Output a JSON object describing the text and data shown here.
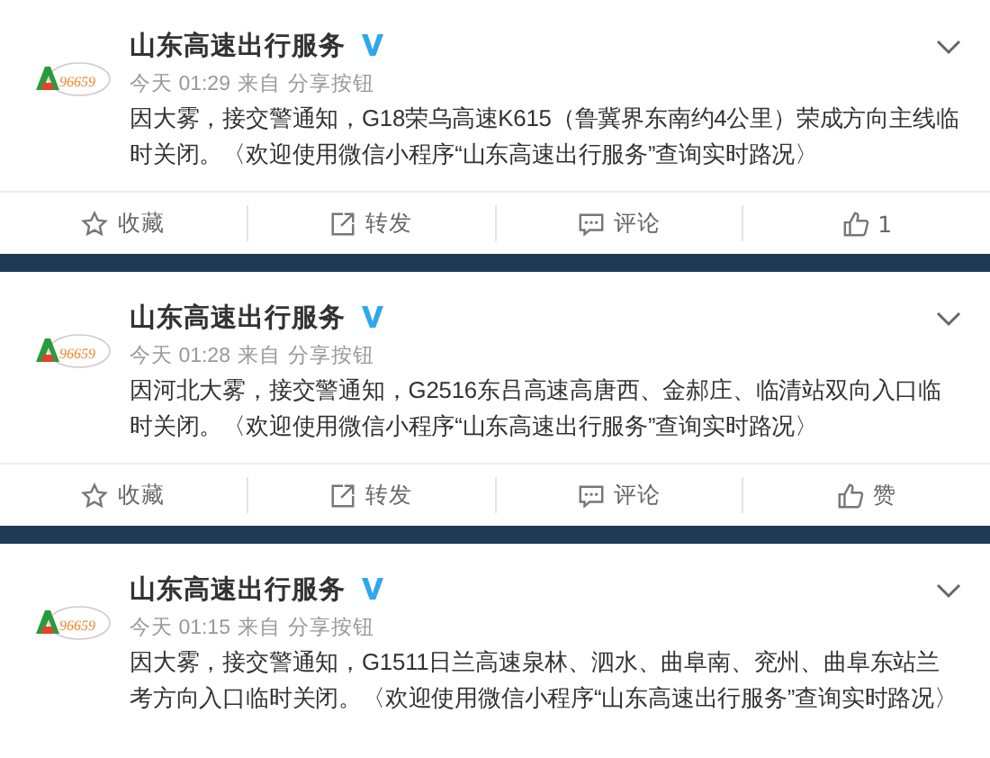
{
  "posts": [
    {
      "author": "山东高速出行服务",
      "verified": true,
      "avatar_label": "96659",
      "time": "今天 01:29",
      "source_prefix": "来自",
      "source": "分享按钮",
      "text": "因大雾，接交警通知，G18荣乌高速K615（鲁冀界东南约4公里）荣成方向主线临时关闭。〈欢迎使用微信小程序“山东高速出行服务”查询实时路况〉",
      "actions": [
        {
          "kind": "favorite",
          "label": "收藏"
        },
        {
          "kind": "repost",
          "label": "转发"
        },
        {
          "kind": "comment",
          "label": "评论"
        },
        {
          "kind": "like",
          "label": "1"
        }
      ]
    },
    {
      "author": "山东高速出行服务",
      "verified": true,
      "avatar_label": "96659",
      "time": "今天 01:28",
      "source_prefix": "来自",
      "source": "分享按钮",
      "text": "因河北大雾，接交警通知，G2516东吕高速高唐西、金郝庄、临清站双向入口临时关闭。〈欢迎使用微信小程序“山东高速出行服务”查询实时路况〉",
      "actions": [
        {
          "kind": "favorite",
          "label": "收藏"
        },
        {
          "kind": "repost",
          "label": "转发"
        },
        {
          "kind": "comment",
          "label": "评论"
        },
        {
          "kind": "like",
          "label": "赞"
        }
      ]
    },
    {
      "author": "山东高速出行服务",
      "verified": true,
      "avatar_label": "96659",
      "time": "今天 01:15",
      "source_prefix": "来自",
      "source": "分享按钮",
      "text": "因大雾，接交警通知，G1511日兰高速泉林、泗水、曲阜南、兖州、曲阜东站兰考方向入口临时关闭。〈欢迎使用微信小程序“山东高速出行服务”查询实时路况〉"
    }
  ]
}
